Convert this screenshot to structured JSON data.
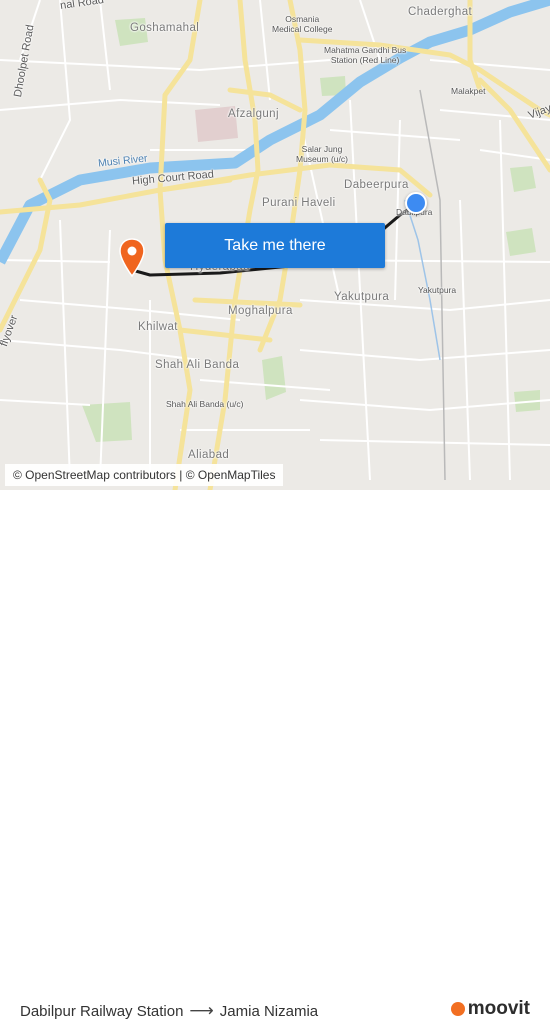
{
  "map": {
    "labels": {
      "nal_road": "nal Road",
      "goshamahal": "Goshamahal",
      "osmania_hospital": "Osmania\nMedical College",
      "chaderghat": "Chaderghat",
      "mgbs": "Mahatma Gandhi Bus\nStation (Red Line)",
      "malakpet": "Malakpet",
      "vijay": "Vijay",
      "dhoolpet_road": "Dhoolpet Road",
      "afzalgunj": "Afzalgunj",
      "musi_river": "Musi River",
      "salar_jung": "Salar Jung\nMuseum (u/c)",
      "high_court_road": "High Court Road",
      "dabeerpura": "Dabeerpura",
      "dabilpura_stop": "Dabilpura",
      "purani_haveli": "Purani Haveli",
      "hyderabad_partial": "Hyderabad",
      "yakutpura_area": "Yakutpura",
      "yakutpura_stop": "Yakutpura",
      "moghalpura": "Moghalpura",
      "khilwat": "Khilwat",
      "flyover": "flyover",
      "shah_ali_banda": "Shah Ali Banda",
      "shah_ali_banda_stop": "Shah Ali Banda (u/c)",
      "aliabad": "Aliabad"
    },
    "origin_color": "#3d8bf2",
    "destination_color": "#f0651f",
    "route_color": "#1a1a1a"
  },
  "cta": {
    "label": "Take me there"
  },
  "attribution": "© OpenStreetMap contributors | © OpenMapTiles",
  "footer": {
    "origin": "Dabilpur Railway Station",
    "destination": "Jamia Nizamia",
    "arrow": "⟶"
  },
  "brand": {
    "name": "moovit",
    "color": "#f26f22"
  }
}
